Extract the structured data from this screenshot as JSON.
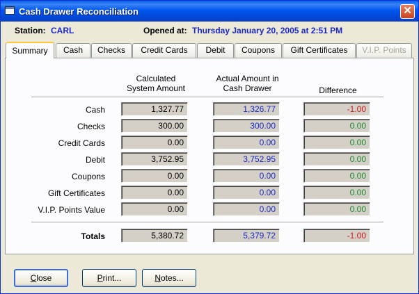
{
  "window": {
    "title": "Cash Drawer Reconciliation",
    "close_glyph": "✕"
  },
  "header": {
    "station_label": "Station:",
    "station_value": "CARL",
    "opened_label": "Opened at:",
    "opened_value": "Thursday January 20, 2005 at 2:51 PM"
  },
  "tabs": [
    {
      "label": "Summary",
      "active": true
    },
    {
      "label": "Cash"
    },
    {
      "label": "Checks"
    },
    {
      "label": "Credit Cards"
    },
    {
      "label": "Debit"
    },
    {
      "label": "Coupons"
    },
    {
      "label": "Gift Certificates"
    },
    {
      "label": "V.I.P. Points",
      "disabled": true
    }
  ],
  "table": {
    "headers": {
      "calc_line1": "Calculated",
      "calc_line2": "System Amount",
      "actual_line1": "Actual Amount in",
      "actual_line2": "Cash Drawer",
      "diff": "Difference"
    },
    "rows": [
      {
        "label": "Cash",
        "calculated": "1,327.77",
        "actual": "1,326.77",
        "difference": "-1.00"
      },
      {
        "label": "Checks",
        "calculated": "300.00",
        "actual": "300.00",
        "difference": "0.00"
      },
      {
        "label": "Credit Cards",
        "calculated": "0.00",
        "actual": "0.00",
        "difference": "0.00"
      },
      {
        "label": "Debit",
        "calculated": "3,752.95",
        "actual": "3,752.95",
        "difference": "0.00"
      },
      {
        "label": "Coupons",
        "calculated": "0.00",
        "actual": "0.00",
        "difference": "0.00"
      },
      {
        "label": "Gift Certificates",
        "calculated": "0.00",
        "actual": "0.00",
        "difference": "0.00"
      },
      {
        "label": "V.I.P. Points Value",
        "calculated": "0.00",
        "actual": "0.00",
        "difference": "0.00"
      }
    ],
    "totals": {
      "label": "Totals",
      "calculated": "5,380.72",
      "actual": "5,379.72",
      "difference": "-1.00"
    }
  },
  "buttons": {
    "close_pre": "",
    "close_key": "C",
    "close_post": "lose",
    "print_pre": "",
    "print_key": "P",
    "print_post": "rint...",
    "notes_pre": "",
    "notes_key": "N",
    "notes_post": "otes..."
  },
  "colors": {
    "title_bar": "#0058ee",
    "negative": "#d01818",
    "zero": "#1c8a2c",
    "actual_text": "#1a28c8",
    "header_value": "#1a28c8"
  }
}
